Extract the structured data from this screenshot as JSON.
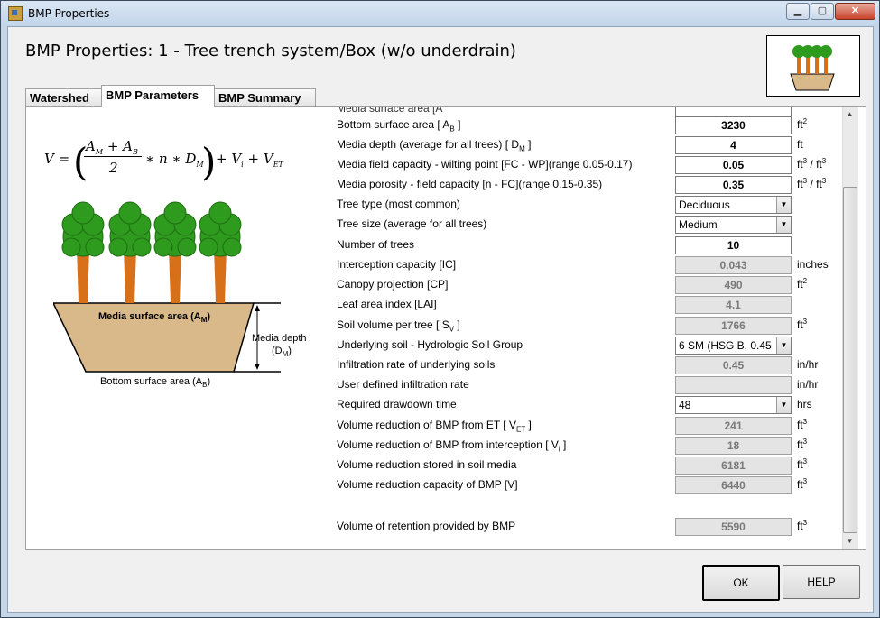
{
  "window": {
    "title": "BMP Properties"
  },
  "header": {
    "title": "BMP Properties: 1 - Tree trench system/Box (w/o underdrain)"
  },
  "tabs": [
    {
      "label": "Watershed"
    },
    {
      "label": "BMP Parameters"
    },
    {
      "label": "BMP Summary"
    }
  ],
  "diagram": {
    "media_surface": "Media surface area (A",
    "media_surface_sub": "M",
    "media_surface_close": ")",
    "media_depth_1": "Media depth",
    "media_depth_2": "(D",
    "media_depth_sub": "M",
    "media_depth_close": ")",
    "bottom_surface": "Bottom surface area (A",
    "bottom_surface_sub": "B",
    "bottom_surface_close": ")"
  },
  "formula": {
    "lhs": "V =",
    "num": "A",
    "num_sub1": "M",
    "plus": " + A",
    "num_sub2": "B",
    "den": "2",
    "mid": "∗ n ∗ D",
    "mid_sub": "M",
    "rest1": "+ V",
    "rest1_sub": "i",
    "rest2": "+ V",
    "rest2_sub": "ET"
  },
  "params": {
    "media_surface_partial": "Media surface area [A",
    "bottom_surface": {
      "label": "Bottom surface area [ A",
      "sub": "B",
      "close": " ]",
      "value": "3230",
      "unit": "ft",
      "unit_sup": "2"
    },
    "media_depth": {
      "label": "Media depth (average for all trees) [ D",
      "sub": "M",
      "close": " ]",
      "value": "4",
      "unit": "ft"
    },
    "field_capacity": {
      "label": "Media field capacity - wilting point [FC - WP](range 0.05-0.17)",
      "value": "0.05",
      "unit_a": "ft",
      "unit_a_sup": "3",
      "unit_mid": " / ft",
      "unit_b_sup": "3"
    },
    "porosity": {
      "label": "Media porosity - field capacity [n - FC](range 0.15-0.35)",
      "value": "0.35",
      "unit_a": "ft",
      "unit_a_sup": "3",
      "unit_mid": " / ft",
      "unit_b_sup": "3"
    },
    "tree_type": {
      "label": "Tree type (most common)",
      "value": "Deciduous"
    },
    "tree_size": {
      "label": "Tree size (average for all trees)",
      "value": "Medium"
    },
    "num_trees": {
      "label": "Number of trees",
      "value": "10"
    },
    "interception_capacity": {
      "label": "Interception capacity [IC]",
      "value": "0.043",
      "unit": "inches"
    },
    "canopy_projection": {
      "label": "Canopy projection [CP]",
      "value": "490",
      "unit": "ft",
      "unit_sup": "2"
    },
    "leaf_area_index": {
      "label": "Leaf area index [LAI]",
      "value": "4.1"
    },
    "soil_volume": {
      "label": "Soil volume per tree [ S",
      "sub": "V",
      "close": " ]",
      "value": "1766",
      "unit": "ft",
      "unit_sup": "3"
    },
    "underlying_soil": {
      "label": "Underlying soil - Hydrologic Soil Group",
      "value": "6 SM (HSG B, 0.45"
    },
    "infiltration_rate": {
      "label": "Infiltration rate of underlying soils",
      "value": "0.45",
      "unit": "in/hr"
    },
    "user_infiltration": {
      "label": "User defined infiltration rate",
      "value": "",
      "unit": "in/hr"
    },
    "drawdown_time": {
      "label": "Required drawdown time",
      "value": "48",
      "unit": "hrs"
    },
    "vol_reduction_et": {
      "label": "Volume reduction of BMP from ET [ V",
      "sub": "ET",
      "close": " ]",
      "value": "241",
      "unit": "ft",
      "unit_sup": "3"
    },
    "vol_reduction_interception": {
      "label": "Volume reduction of BMP from interception [ V",
      "sub": "i",
      "close": " ]",
      "value": "18",
      "unit": "ft",
      "unit_sup": "3"
    },
    "vol_reduction_soil": {
      "label": "Volume reduction stored in soil media",
      "value": "6181",
      "unit": "ft",
      "unit_sup": "3"
    },
    "vol_reduction_capacity": {
      "label": "Volume reduction capacity of BMP [V]",
      "value": "6440",
      "unit": "ft",
      "unit_sup": "3"
    },
    "vol_retention": {
      "label": "Volume of retention provided by BMP",
      "value": "5590",
      "unit": "ft",
      "unit_sup": "3"
    }
  },
  "buttons": {
    "ok": "OK",
    "help": "HELP"
  },
  "colors": {
    "tree_green": "#2e9a1e",
    "trunk": "#d8701a",
    "soil": "#d9b88a"
  }
}
